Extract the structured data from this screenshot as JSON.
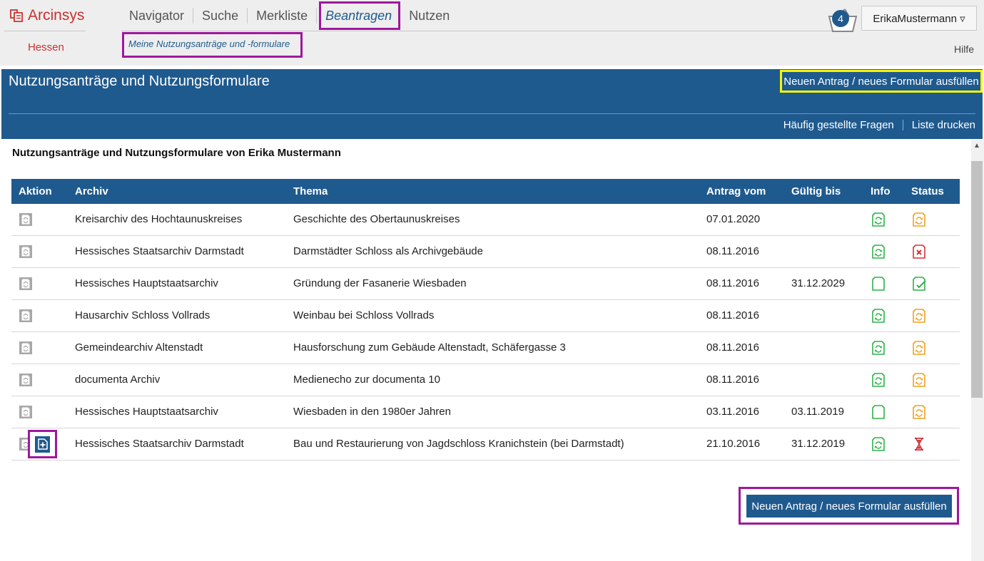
{
  "app": {
    "name": "Arcinsys",
    "region": "Hessen"
  },
  "nav": {
    "items": [
      "Navigator",
      "Suche",
      "Merkliste",
      "Beantragen",
      "Nutzen"
    ],
    "active": "Beantragen",
    "sub_item": "Meine Nutzungsanträge und -formulare"
  },
  "basket": {
    "count": "4",
    "icon": "basket-icon"
  },
  "user": {
    "label": "ErikaMustermann ▿"
  },
  "help": "Hilfe",
  "band": {
    "title": "Nutzungsanträge und Nutzungsformulare",
    "new_button": "Neuen Antrag / neues Formular ausfüllen",
    "links": [
      "Häufig gestellte Fragen",
      "Liste drucken"
    ]
  },
  "content": {
    "title": "Nutzungsanträge und Nutzungsformulare von Erika Mustermann",
    "columns": [
      "Aktion",
      "Archiv",
      "Thema",
      "Antrag vom",
      "Gültig bis",
      "Info",
      "Status"
    ],
    "rows": [
      {
        "archiv": "Kreisarchiv des Hochtaunuskreises",
        "thema": "Geschichte des Obertaunuskreises",
        "antrag": "07.01.2020",
        "gueltig": "",
        "info": "doc-sync-icon",
        "status": "doc-pending-icon"
      },
      {
        "archiv": "Hessisches Staatsarchiv Darmstadt",
        "thema": "Darmstädter Schloss als Archivgebäude",
        "antrag": "08.11.2016",
        "gueltig": "",
        "info": "doc-sync-icon",
        "status": "doc-rejected-icon"
      },
      {
        "archiv": "Hessisches Hauptstaatsarchiv",
        "thema": "Gründung der Fasanerie Wiesbaden",
        "antrag": "08.11.2016",
        "gueltig": "31.12.2029",
        "info": "doc-blank-icon",
        "status": "doc-approved-icon"
      },
      {
        "archiv": "Hausarchiv Schloss Vollrads",
        "thema": "Weinbau bei Schloss Vollrads",
        "antrag": "08.11.2016",
        "gueltig": "",
        "info": "doc-sync-icon",
        "status": "doc-pending-icon"
      },
      {
        "archiv": "Gemeindearchiv Altenstadt",
        "thema": "Hausforschung zum Gebäude Altenstadt, Schäfergasse 3",
        "antrag": "08.11.2016",
        "gueltig": "",
        "info": "doc-sync-icon",
        "status": "doc-pending-icon"
      },
      {
        "archiv": "documenta Archiv",
        "thema": "Medienecho zur documenta 10",
        "antrag": "08.11.2016",
        "gueltig": "",
        "info": "doc-sync-icon",
        "status": "doc-pending-icon"
      },
      {
        "archiv": "Hessisches Hauptstaatsarchiv",
        "thema": "Wiesbaden in den 1980er Jahren",
        "antrag": "03.11.2016",
        "gueltig": "03.11.2019",
        "info": "doc-blank-icon",
        "status": "doc-pending-icon"
      },
      {
        "archiv": "Hessisches Staatsarchiv Darmstadt",
        "thema": "Bau und Restaurierung von Jagdschloss Kranichstein (bei Darmstadt)",
        "antrag": "21.10.2016",
        "gueltig": "31.12.2019",
        "info": "doc-sync-icon",
        "status": "hourglass-icon"
      }
    ]
  },
  "bottom_button": "Neuen Antrag / neues Formular ausfüllen",
  "colors": {
    "brand": "#c8322f",
    "primary": "#1f5a8e",
    "highlight_magenta": "#a0179d",
    "highlight_yellow": "#f7f500",
    "icon_green": "#2db24a",
    "icon_orange": "#f0a020",
    "icon_red": "#d0333a",
    "icon_grey": "#a8a8a8"
  }
}
